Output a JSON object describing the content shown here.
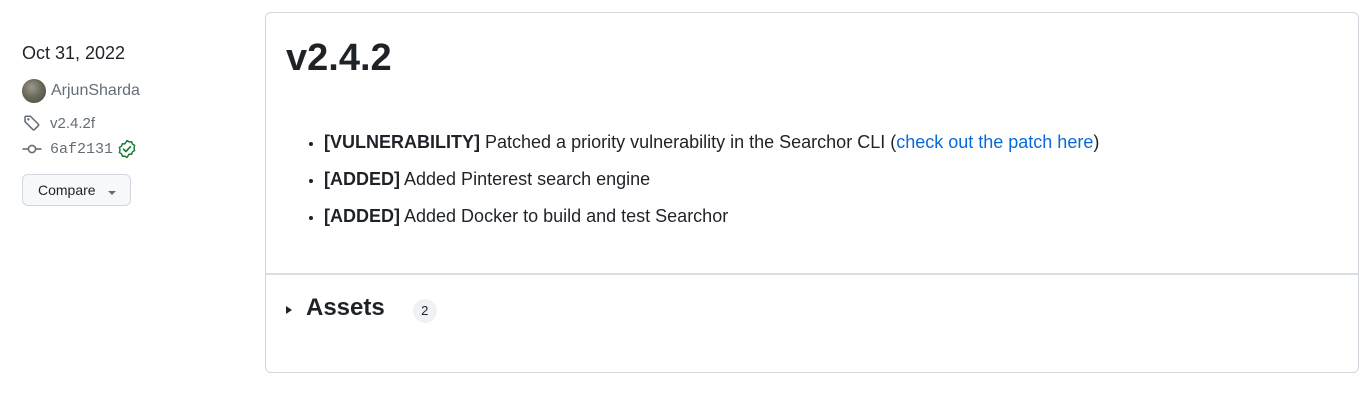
{
  "sidebar": {
    "date": "Oct 31, 2022",
    "author": "ArjunSharda",
    "tag": "v2.4.2f",
    "commit": "6af2131",
    "compare_label": "Compare"
  },
  "release": {
    "title": "v2.4.2",
    "notes": [
      {
        "tag": "[VULNERABILITY]",
        "text_before": " Patched a priority vulnerability in the Searchor CLI (",
        "link": "check out the patch here",
        "text_after": ")"
      },
      {
        "tag": "[ADDED]",
        "text": " Added Pinterest search engine"
      },
      {
        "tag": "[ADDED]",
        "text": " Added Docker to build and test Searchor"
      }
    ],
    "assets_label": "Assets",
    "assets_count": "2"
  },
  "colors": {
    "link": "#0969da",
    "verified": "#1a7f37",
    "muted": "#656d76",
    "border": "#d0d7de"
  },
  "icons": {
    "tag": "tag-icon",
    "commit": "git-commit-icon",
    "verified": "verified-check-icon",
    "caret": "triangle-down-icon",
    "expand": "triangle-right-icon"
  }
}
